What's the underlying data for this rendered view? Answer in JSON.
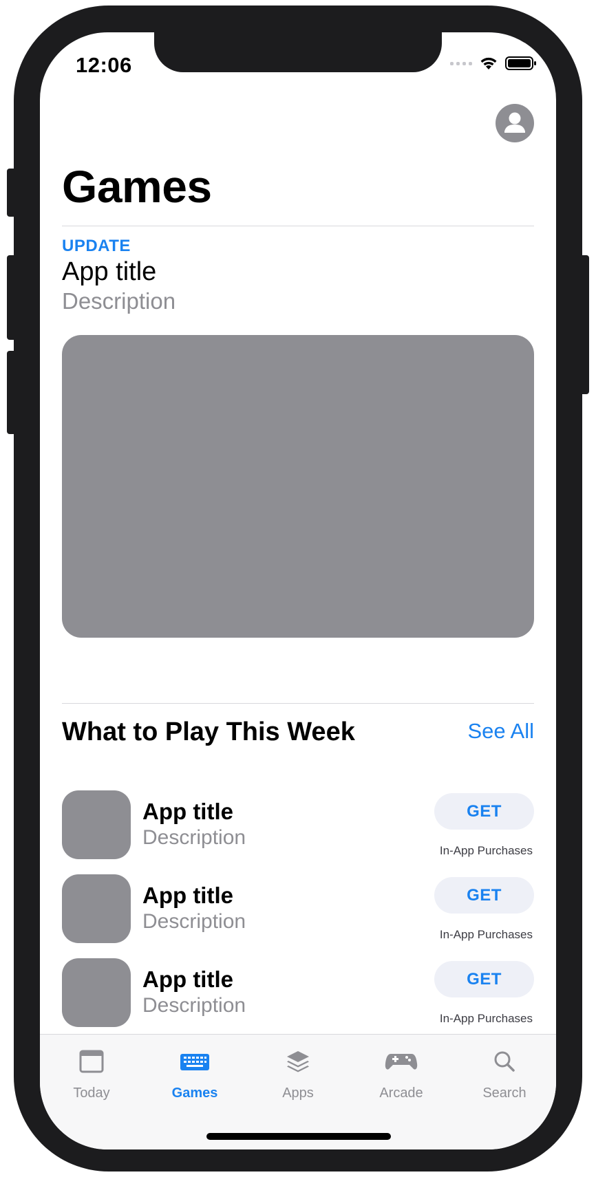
{
  "status_bar": {
    "time": "12:06"
  },
  "header": {
    "title": "Games",
    "profile_icon": "person-circle-icon"
  },
  "featured": {
    "eyebrow": "UPDATE",
    "title": "App title",
    "description": "Description"
  },
  "section": {
    "title": "What to Play This Week",
    "see_all": "See All"
  },
  "apps": [
    {
      "title": "App title",
      "description": "Description",
      "button": "GET",
      "note": "In-App Purchases"
    },
    {
      "title": "App title",
      "description": "Description",
      "button": "GET",
      "note": "In-App Purchases"
    },
    {
      "title": "App title",
      "description": "Description",
      "button": "GET",
      "note": "In-App Purchases"
    }
  ],
  "tab_bar": {
    "tabs": [
      {
        "label": "Today",
        "icon": "today-icon",
        "active": false
      },
      {
        "label": "Games",
        "icon": "games-keyboard-icon",
        "active": true
      },
      {
        "label": "Apps",
        "icon": "apps-stack-icon",
        "active": false
      },
      {
        "label": "Arcade",
        "icon": "arcade-controller-icon",
        "active": false
      },
      {
        "label": "Search",
        "icon": "search-icon",
        "active": false
      }
    ]
  },
  "colors": {
    "accent": "#1a82f0",
    "placeholder": "#8e8e93",
    "button_bg": "#eef0f7",
    "device_frame": "#1c1c1e"
  }
}
